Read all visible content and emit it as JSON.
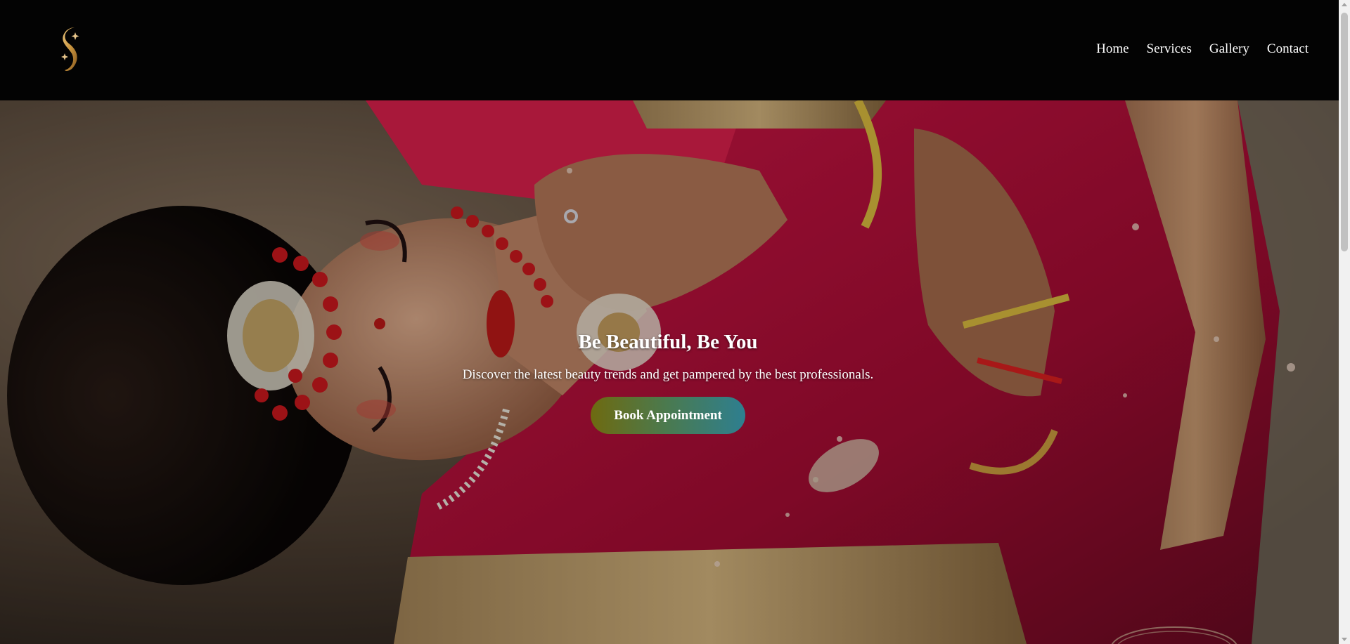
{
  "header": {
    "logo_icon": "swirl-s-logo-icon",
    "nav": [
      {
        "label": "Home"
      },
      {
        "label": "Services"
      },
      {
        "label": "Gallery"
      },
      {
        "label": "Contact"
      }
    ]
  },
  "hero": {
    "title": "Be Beautiful, Be You",
    "subtitle": "Discover the latest beauty trends and get pampered by the best professionals.",
    "cta_label": "Book Appointment",
    "background_icon": "bride-photo-image"
  },
  "colors": {
    "header_bg": "#030303",
    "cta_gradient_start": "#6e6a10",
    "cta_gradient_end": "#2e7f90",
    "logo_gold": "#c9a04a",
    "saree_red": "#c01238"
  }
}
